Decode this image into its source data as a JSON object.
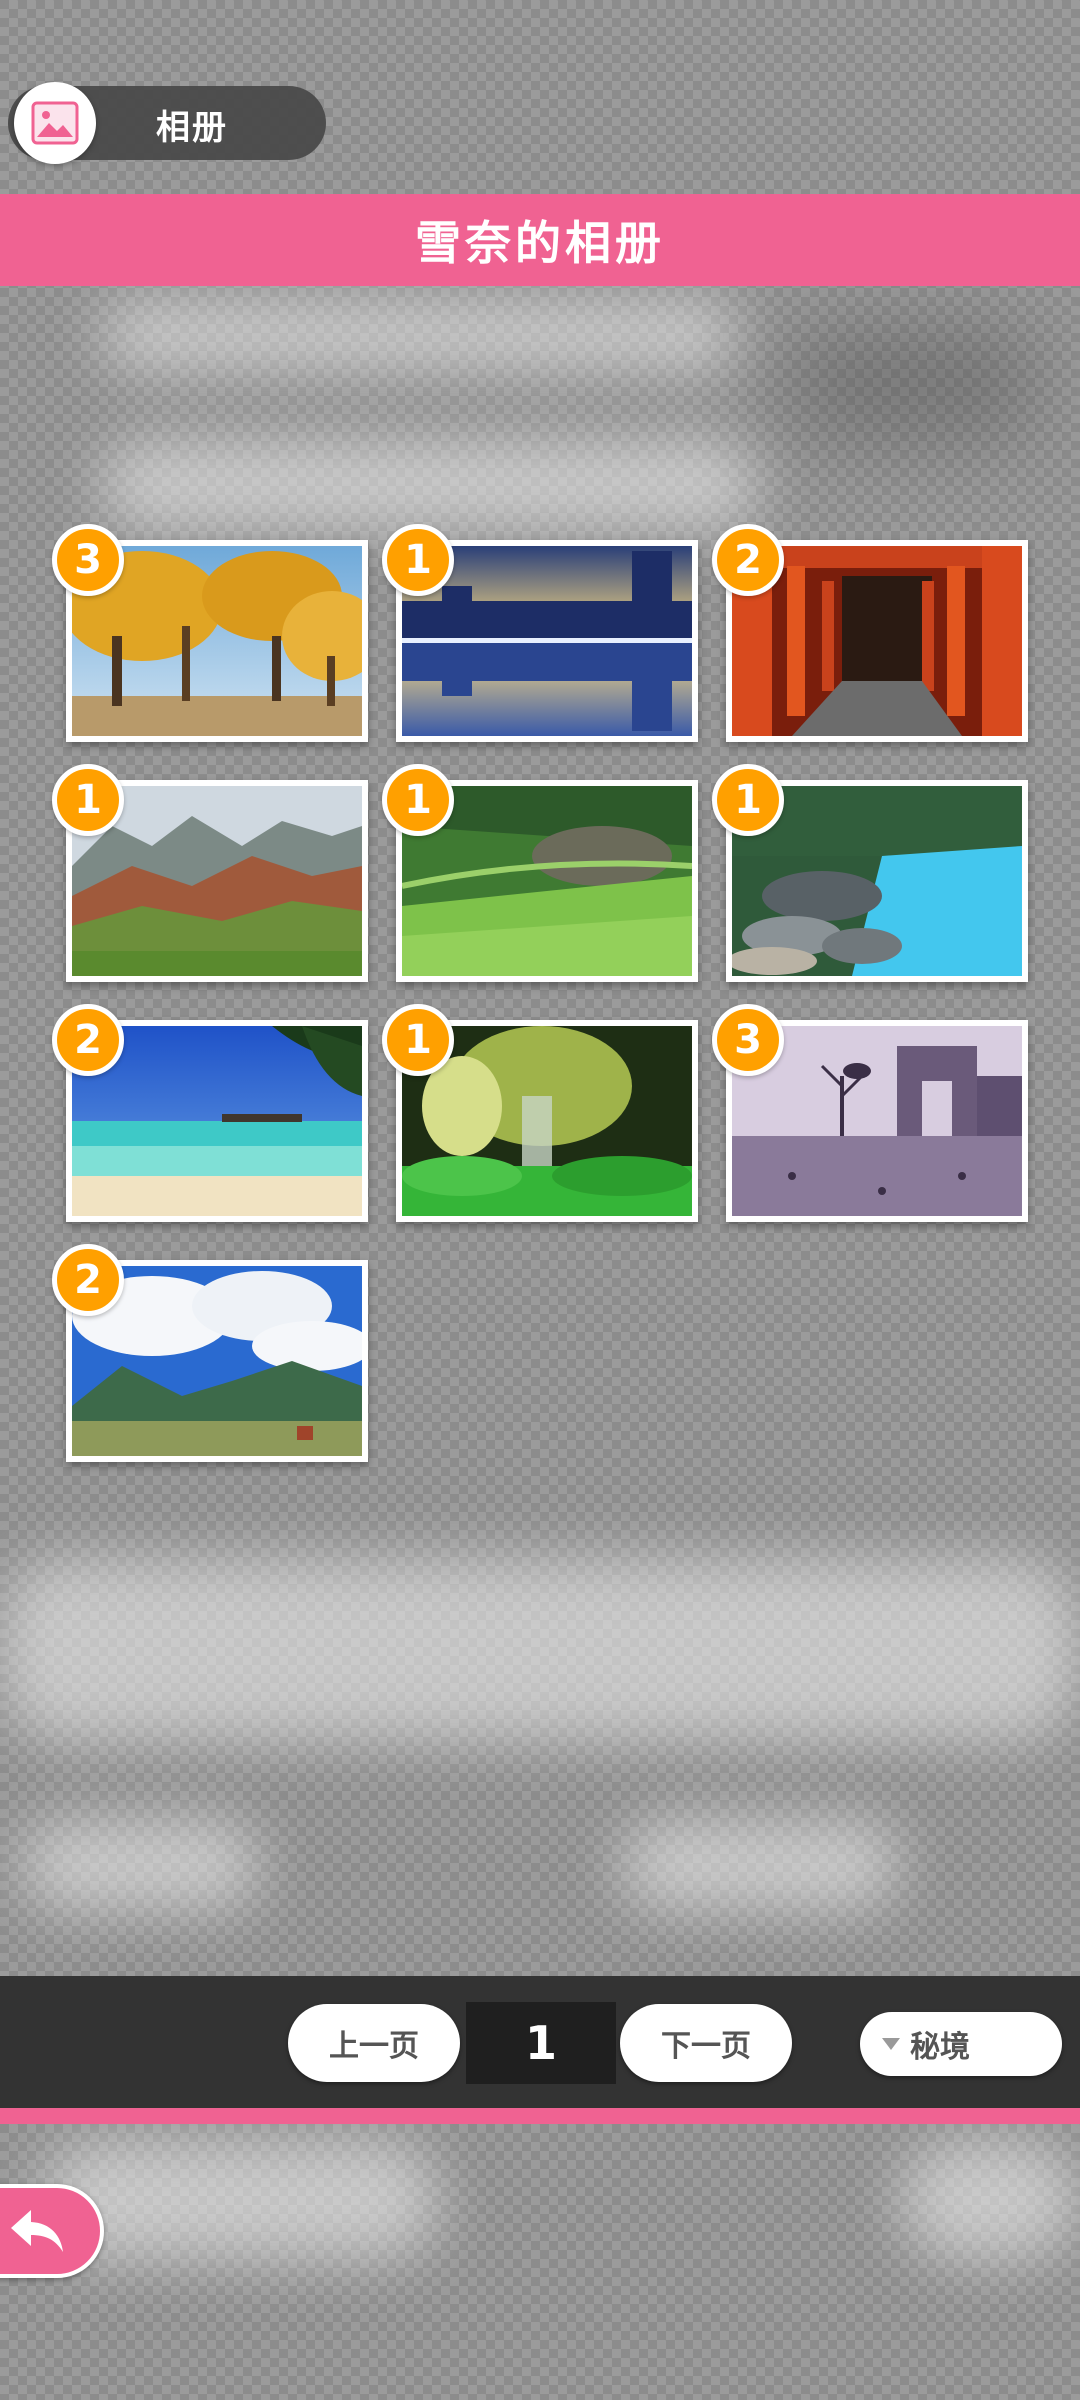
{
  "header": {
    "album_label": "相册",
    "title": "雪奈的相册"
  },
  "photos": [
    {
      "count": "3",
      "scene": "autumn poplar forest"
    },
    {
      "count": "1",
      "scene": "city skyline reflection"
    },
    {
      "count": "2",
      "scene": "red torii gate tunnel"
    },
    {
      "count": "1",
      "scene": "colorful mountains"
    },
    {
      "count": "1",
      "scene": "green terraced hills"
    },
    {
      "count": "1",
      "scene": "turquoise lake with rocks"
    },
    {
      "count": "2",
      "scene": "tropical beach"
    },
    {
      "count": "1",
      "scene": "jungle waterfall"
    },
    {
      "count": "3",
      "scene": "arch square with birds"
    },
    {
      "count": "2",
      "scene": "mountain meadow with horse"
    }
  ],
  "pagination": {
    "prev_label": "上一页",
    "current_page": "1",
    "next_label": "下一页"
  },
  "filter": {
    "selected": "秘境"
  },
  "colors": {
    "accent_pink": "#f06292",
    "badge_orange": "#ffa000"
  }
}
